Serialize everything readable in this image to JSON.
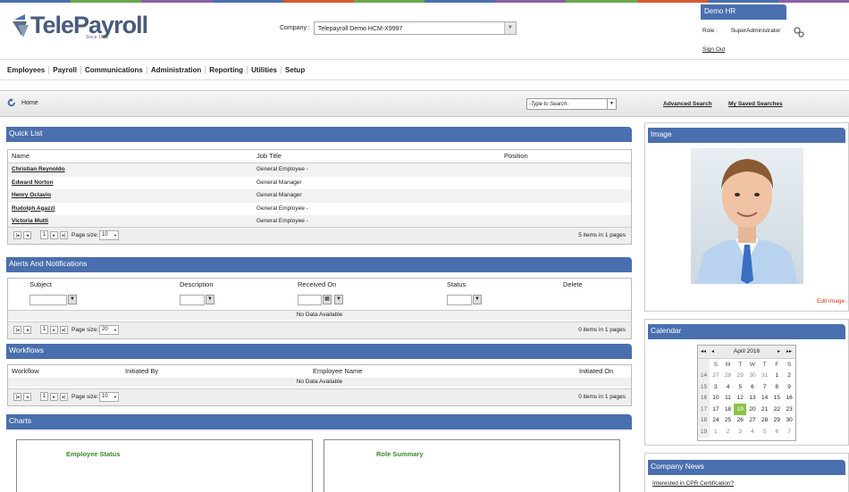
{
  "colors": [
    "#4a6fae",
    "#6aa84f",
    "#8e5ea2",
    "#4a6fae",
    "#d65a31",
    "#6aa84f",
    "#4a6fae",
    "#8e5ea2",
    "#6aa84f",
    "#d65a31",
    "#4a6fae",
    "#8e5ea2"
  ],
  "logo": {
    "name": "TelePayroll",
    "since": "Since 1983"
  },
  "company": {
    "label": "Company :",
    "value": "Telepayroll Demo HCM-X9997"
  },
  "user": {
    "name": "Demo HR",
    "role_label": "Role :",
    "role": "SuperAdministrator",
    "signout": "Sign Out"
  },
  "nav": [
    "Employees",
    "Payroll",
    "Communications",
    "Administration",
    "Reporting",
    "Utilities",
    "Setup"
  ],
  "breadcrumb": {
    "home": "Home",
    "search_placeholder": "-Type to Search-",
    "advanced_search": "Advanced Search",
    "saved_searches": "My Saved Searches"
  },
  "quick_list": {
    "title": "Quick List",
    "columns": [
      "Name",
      "Job Title",
      "Position"
    ],
    "rows": [
      {
        "name": "Christian Reynoldo",
        "job": "General Employee -"
      },
      {
        "name": "Edward Norton",
        "job": "General Manager"
      },
      {
        "name": "Henry Octavio",
        "job": "General Manager"
      },
      {
        "name": "Rudolph Agazzi",
        "job": "General Employee -"
      },
      {
        "name": "Victoria Mutti",
        "job": "General Employee -"
      }
    ],
    "page": "1",
    "page_size_label": "Page size:",
    "page_size": "10",
    "info": "5 items in 1 pages"
  },
  "alerts": {
    "title": "Alerts And Notifications",
    "columns": [
      "Subject",
      "Description",
      "Received On",
      "Status",
      "Delete"
    ],
    "no_data": "No Data Available",
    "page": "1",
    "page_size_label": "Page size:",
    "page_size": "20",
    "info": "0 items in 1 pages"
  },
  "workflows": {
    "title": "Workflows",
    "columns": [
      "Workflow",
      "Initiated By",
      "Employee Name",
      "Initiated On"
    ],
    "no_data": "No Data Available",
    "page": "1",
    "page_size_label": "Page size:",
    "page_size": "10",
    "info": "0 items in 1 pages"
  },
  "charts": {
    "title": "Charts",
    "employee_status": "Employee Status",
    "role_summary": "Role Summary"
  },
  "image_panel": {
    "title": "Image",
    "edit": "Edit Image"
  },
  "calendar": {
    "title": "Calendar",
    "month": "April 2016",
    "nav": {
      "first": "◂◂",
      "prev": "◂",
      "next": "▸",
      "last": "▸▸"
    },
    "days": [
      "S",
      "M",
      "T",
      "W",
      "T",
      "F",
      "S"
    ],
    "weeks": [
      {
        "wk": "14",
        "d": [
          "27",
          "28",
          "29",
          "30",
          "31",
          "1",
          "2"
        ]
      },
      {
        "wk": "15",
        "d": [
          "3",
          "4",
          "5",
          "6",
          "7",
          "8",
          "9"
        ]
      },
      {
        "wk": "16",
        "d": [
          "10",
          "11",
          "12",
          "13",
          "14",
          "15",
          "16"
        ]
      },
      {
        "wk": "17",
        "d": [
          "17",
          "18",
          "19",
          "20",
          "21",
          "22",
          "23"
        ]
      },
      {
        "wk": "18",
        "d": [
          "24",
          "25",
          "26",
          "27",
          "28",
          "29",
          "30"
        ]
      },
      {
        "wk": "19",
        "d": [
          "1",
          "2",
          "3",
          "4",
          "5",
          "6",
          "7"
        ]
      }
    ],
    "today": "19"
  },
  "news": {
    "title": "Company News",
    "item": "Interested in CPR Certification?"
  }
}
